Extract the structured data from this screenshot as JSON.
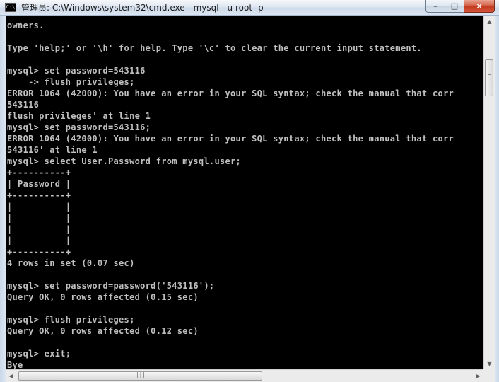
{
  "window": {
    "title": "管理员: C:\\Windows\\system32\\cmd.exe - mysql  -u root -p",
    "icon_text": "C:\\",
    "minimize_label": "–",
    "maximize_label": "□",
    "close_label": "✕"
  },
  "console": {
    "lines": [
      "owners.",
      "",
      "Type 'help;' or '\\h' for help. Type '\\c' to clear the current input statement.",
      "",
      "mysql> set password=543116",
      "    -> flush privileges;",
      "ERROR 1064 (42000): You have an error in your SQL syntax; check the manual that corr",
      "543116",
      "flush privileges' at line 1",
      "mysql> set password=543116;",
      "ERROR 1064 (42000): You have an error in your SQL syntax; check the manual that corr",
      "543116' at line 1",
      "mysql> select User.Password from mysql.user;",
      "+----------+",
      "| Password |",
      "+----------+",
      "|          |",
      "|          |",
      "|          |",
      "|          |",
      "+----------+",
      "4 rows in set (0.07 sec)",
      "",
      "mysql> set password=password('543116');",
      "Query OK, 0 rows affected (0.15 sec)",
      "",
      "mysql> flush privileges;",
      "Query OK, 0 rows affected (0.12 sec)",
      "",
      "mysql> exit;",
      "Bye"
    ]
  },
  "scrollbars": {
    "vertical_up_icon": "▲",
    "vertical_down_icon": "▼",
    "horizontal_left_icon": "◀",
    "horizontal_right_icon": "▶",
    "horizontal_thumb_grip": "|||"
  },
  "colors": {
    "console_background": "#000000",
    "console_text": "#c0c0c0",
    "close_button": "#c2391f"
  }
}
